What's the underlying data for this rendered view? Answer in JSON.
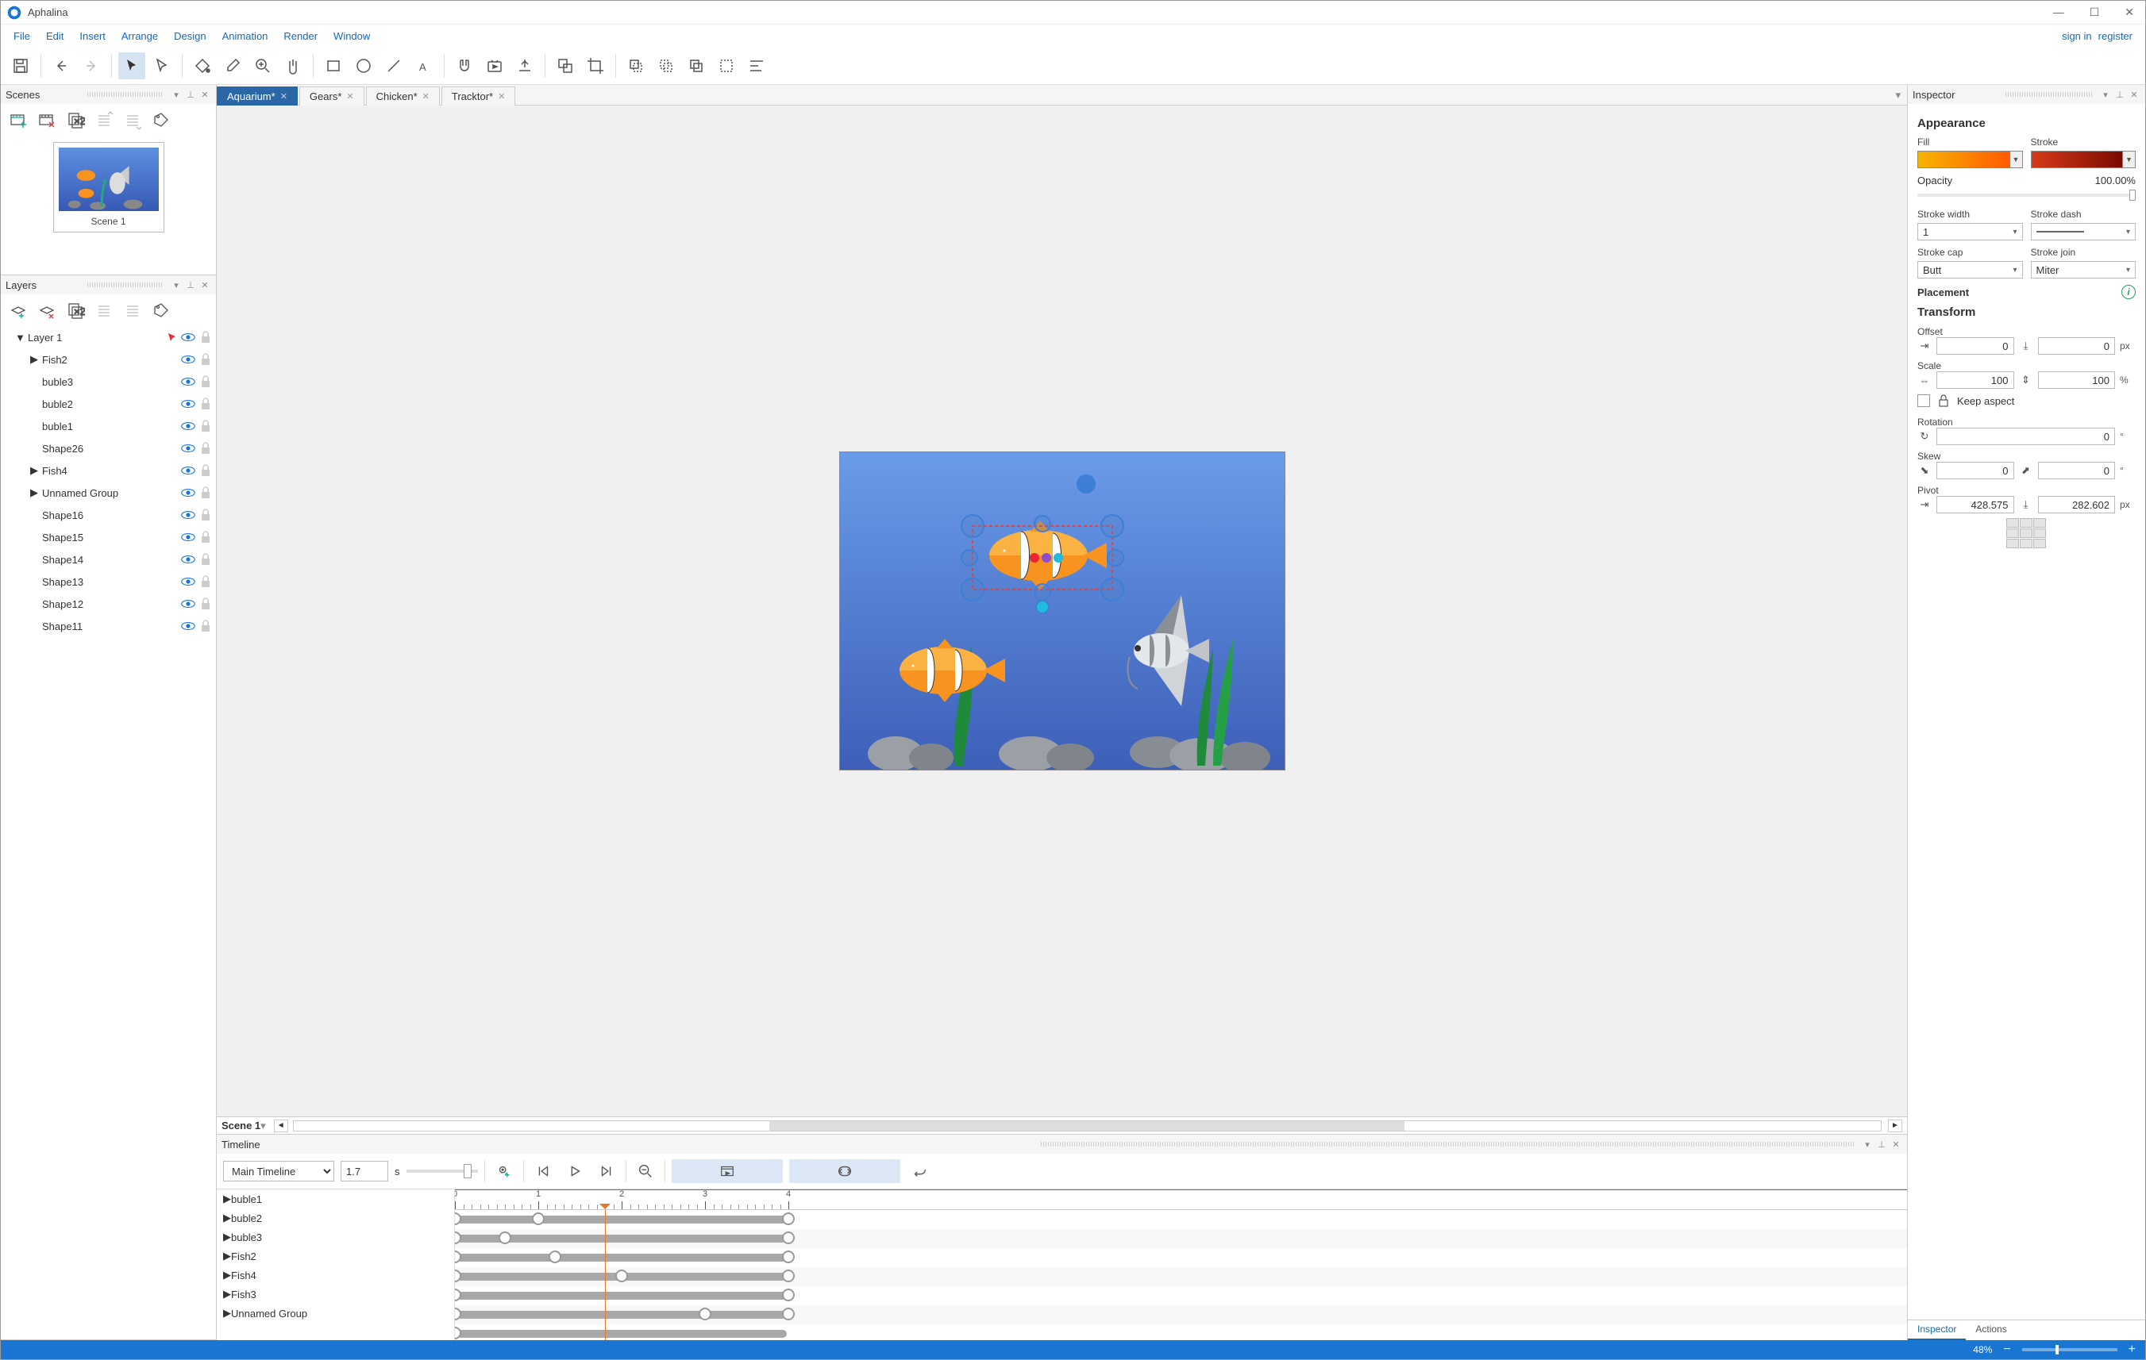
{
  "app": {
    "title": "Aphalina"
  },
  "window_buttons": {
    "min": "—",
    "max": "☐",
    "close": "✕"
  },
  "menu": [
    "File",
    "Edit",
    "Insert",
    "Arrange",
    "Design",
    "Animation",
    "Render",
    "Window"
  ],
  "auth": {
    "signin": "sign in",
    "register": "register"
  },
  "panels": {
    "scenes": {
      "title": "Scenes",
      "thumb_label": "Scene 1"
    },
    "layers": {
      "title": "Layers",
      "items": [
        {
          "name": "Layer 1",
          "depth": 0,
          "exp": "▼",
          "cursor": true
        },
        {
          "name": "Fish2",
          "depth": 1,
          "exp": "▶"
        },
        {
          "name": "buble3",
          "depth": 1
        },
        {
          "name": "buble2",
          "depth": 1
        },
        {
          "name": "buble1",
          "depth": 1
        },
        {
          "name": "Shape26",
          "depth": 1
        },
        {
          "name": "Fish4",
          "depth": 1,
          "exp": "▶"
        },
        {
          "name": "Unnamed Group",
          "depth": 1,
          "exp": "▶"
        },
        {
          "name": "Shape16",
          "depth": 1
        },
        {
          "name": "Shape15",
          "depth": 1
        },
        {
          "name": "Shape14",
          "depth": 1
        },
        {
          "name": "Shape13",
          "depth": 1
        },
        {
          "name": "Shape12",
          "depth": 1
        },
        {
          "name": "Shape11",
          "depth": 1
        }
      ]
    },
    "inspector": {
      "title": "Inspector",
      "appearance": "Appearance",
      "fill": "Fill",
      "stroke": "Stroke",
      "opacity_label": "Opacity",
      "opacity_val": "100.00%",
      "stroke_width": "Stroke width",
      "stroke_width_val": "1",
      "stroke_dash": "Stroke dash",
      "stroke_cap": "Stroke cap",
      "stroke_cap_val": "Butt",
      "stroke_join": "Stroke join",
      "stroke_join_val": "Miter",
      "placement": "Placement",
      "transform": "Transform",
      "offset": "Offset",
      "offset_x": "0",
      "offset_y": "0",
      "offset_unit": "px",
      "scale": "Scale",
      "scale_x": "100",
      "scale_y": "100",
      "scale_unit": "%",
      "keep_aspect": "Keep aspect",
      "rotation": "Rotation",
      "rotation_val": "0",
      "deg": "°",
      "skew": "Skew",
      "skew_x": "0",
      "skew_y": "0",
      "pivot": "Pivot",
      "pivot_x": "428.575",
      "pivot_y": "282.602",
      "pivot_unit": "px",
      "tabs": [
        "Inspector",
        "Actions"
      ]
    }
  },
  "doctabs": [
    {
      "label": "Aquarium*",
      "active": true
    },
    {
      "label": "Gears*"
    },
    {
      "label": "Chicken*"
    },
    {
      "label": "Tracktor*"
    }
  ],
  "scene_strip": {
    "name": "Scene 1"
  },
  "timeline": {
    "title": "Timeline",
    "main_select": "Main Timeline",
    "time_val": "1.7",
    "time_unit": "s",
    "ruler_marks": [
      "0",
      "1",
      "2",
      "3",
      "4"
    ],
    "tracks": [
      {
        "name": "buble1",
        "kf": [
          0,
          25,
          100
        ]
      },
      {
        "name": "buble2",
        "kf": [
          0,
          15,
          100
        ]
      },
      {
        "name": "buble3",
        "kf": [
          0,
          30,
          100
        ]
      },
      {
        "name": "Fish2",
        "kf": [
          0,
          50,
          100
        ]
      },
      {
        "name": "Fish4",
        "kf": [
          0,
          100
        ]
      },
      {
        "name": "Fish3",
        "kf": [
          0,
          75,
          100
        ]
      },
      {
        "name": "Unnamed Group",
        "kf": [
          0
        ]
      }
    ],
    "playhead_pct": 45
  },
  "status": {
    "zoom": "48%"
  },
  "colors": {
    "fill_grad_from": "#f7b500",
    "fill_grad_to": "#ff5a00",
    "stroke_grad_from": "#d83a1a",
    "stroke_grad_to": "#7a0a00"
  }
}
